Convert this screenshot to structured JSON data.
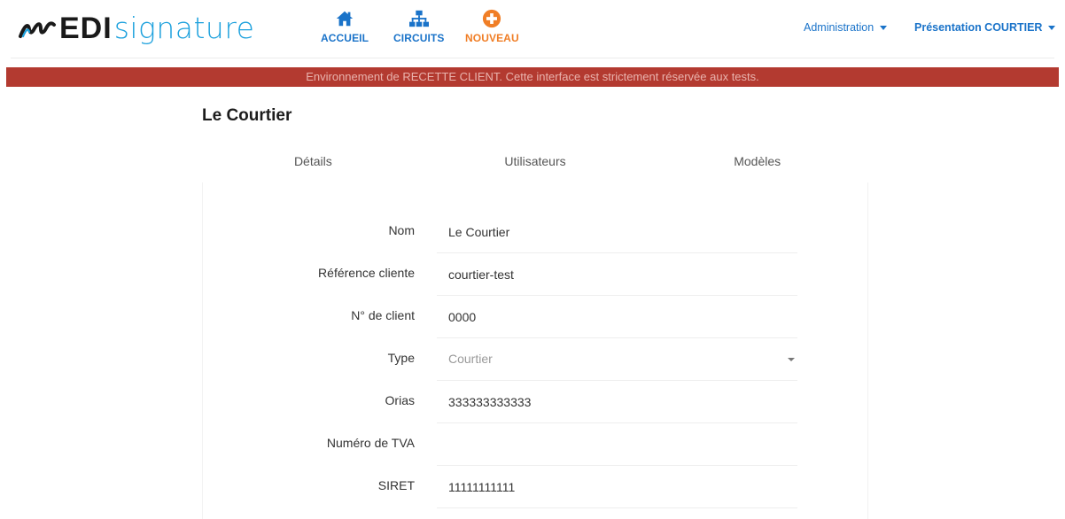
{
  "brand": {
    "edi": "EDI",
    "signature": "signature"
  },
  "nav": {
    "accueil": "ACCUEIL",
    "circuits": "CIRCUITS",
    "nouveau": "NOUVEAU"
  },
  "menus": {
    "administration": "Administration",
    "user": "Présentation COURTIER"
  },
  "banner": "Environnement de RECETTE CLIENT. Cette interface est strictement réservée aux tests.",
  "page": {
    "title": "Le Courtier"
  },
  "tabs": [
    {
      "label": "Détails"
    },
    {
      "label": "Utilisateurs"
    },
    {
      "label": "Modèles"
    }
  ],
  "form": {
    "nom": {
      "label": "Nom",
      "value": "Le Courtier"
    },
    "reference": {
      "label": "Référence cliente",
      "value": "courtier-test"
    },
    "numero_client": {
      "label": "N° de client",
      "value": "0000"
    },
    "type": {
      "label": "Type",
      "value": "Courtier"
    },
    "orias": {
      "label": "Orias",
      "value": "333333333333"
    },
    "tva": {
      "label": "Numéro de TVA",
      "value": ""
    },
    "siret": {
      "label": "SIRET",
      "value": "11111111111"
    }
  },
  "colors": {
    "brand_blue": "#1da1dd",
    "link_blue": "#1a73c9",
    "accent_orange": "#f07e26",
    "banner_red": "#b33a30"
  },
  "icons": {
    "accueil": "home-icon",
    "circuits": "sitemap-icon",
    "nouveau": "plus-circle-icon"
  }
}
